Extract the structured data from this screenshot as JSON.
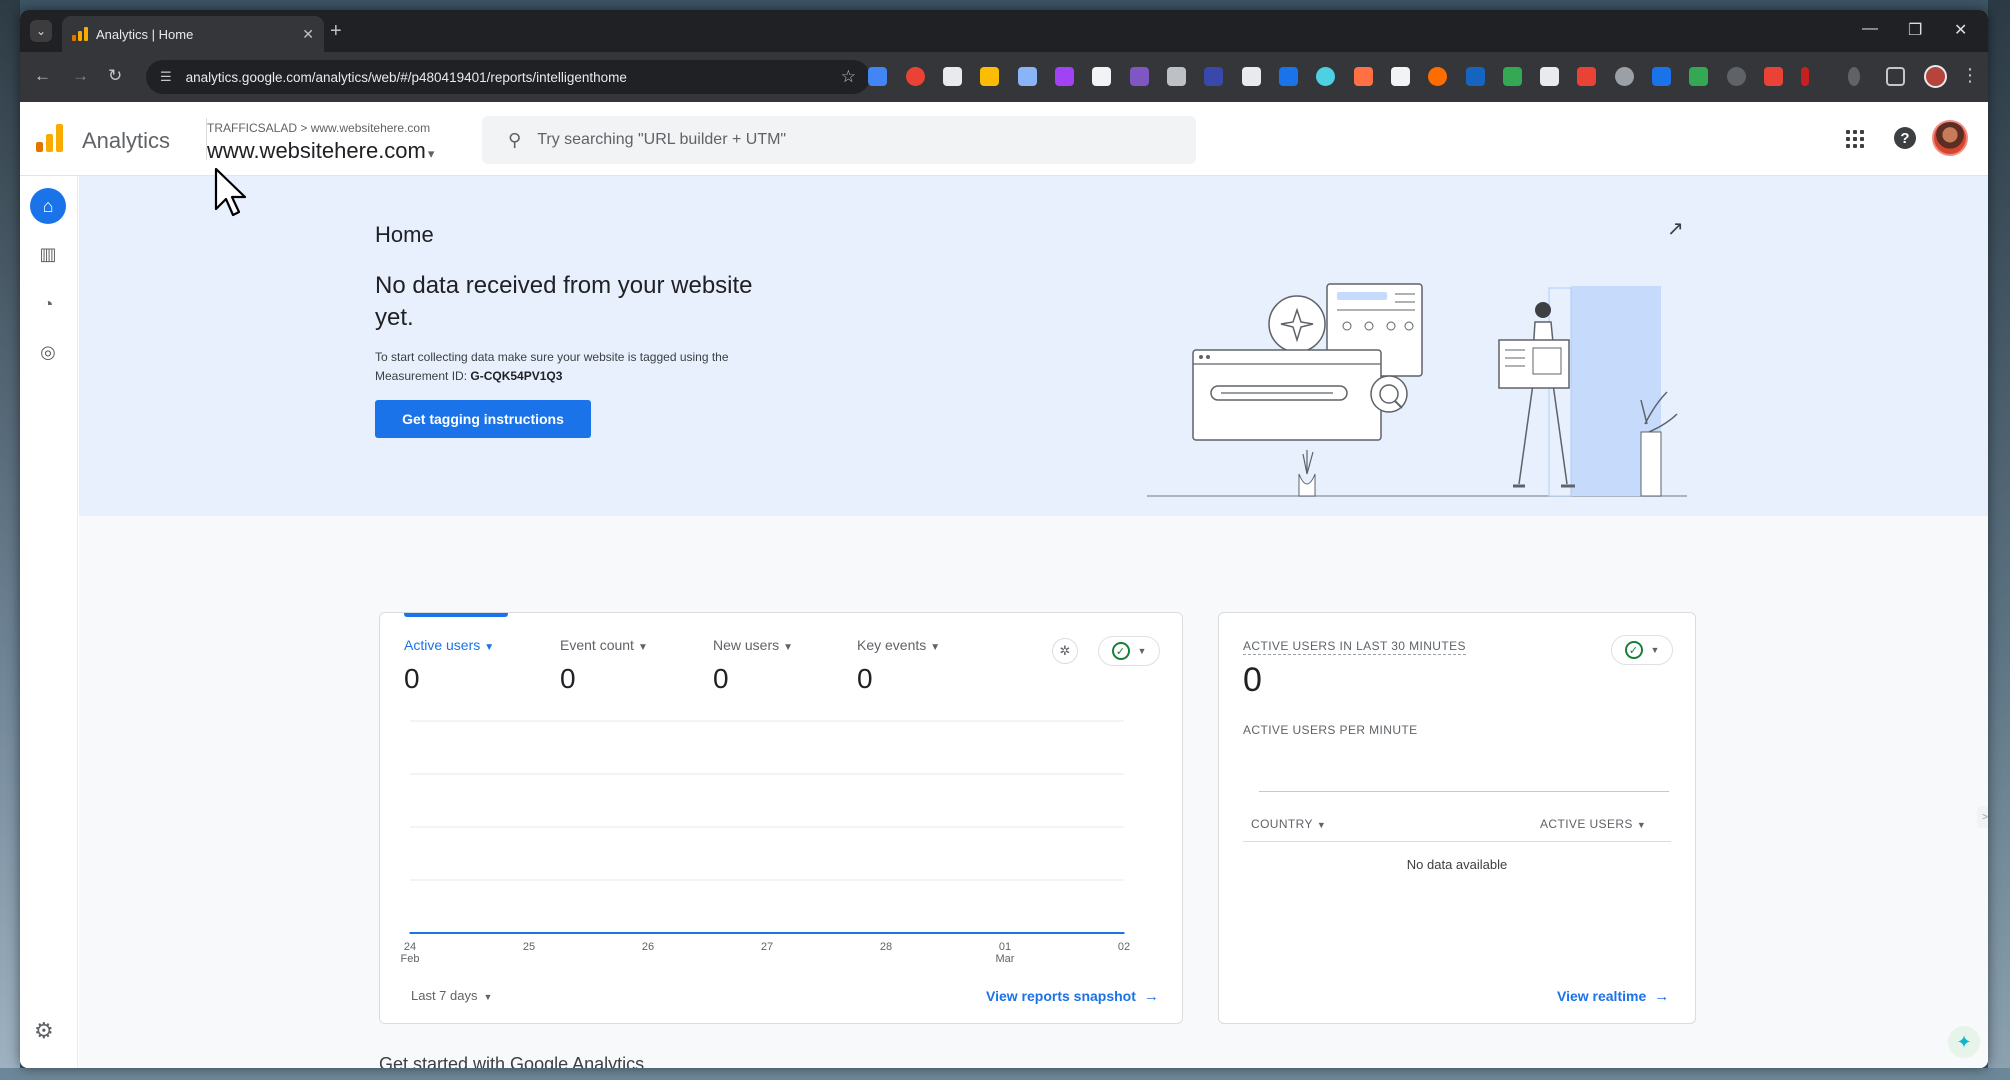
{
  "browser": {
    "tab_title": "Analytics | Home",
    "url": "analytics.google.com/analytics/web/#/p480419401/reports/intelligenthome"
  },
  "header": {
    "brand": "Analytics",
    "breadcrumb_account": "TRAFFICSALAD",
    "breadcrumb_sep": ">",
    "breadcrumb_property": "www.websitehere.com",
    "property_name": "www.websitehere.com",
    "search_placeholder": "Try searching \"URL builder + UTM\""
  },
  "hero": {
    "page_title": "Home",
    "heading": "No data received from your website yet.",
    "body_prefix": "To start collecting data make sure your website is tagged using the Measurement ID: ",
    "measurement_id": "G-CQK54PV1Q3",
    "cta_label": "Get tagging instructions"
  },
  "overview_card": {
    "metrics": [
      {
        "label": "Active users",
        "value": "0",
        "selected": true
      },
      {
        "label": "Event count",
        "value": "0",
        "selected": false
      },
      {
        "label": "New users",
        "value": "0",
        "selected": false
      },
      {
        "label": "Key events",
        "value": "0",
        "selected": false
      }
    ],
    "date_range": "Last 7 days",
    "link_label": "View reports snapshot"
  },
  "chart_data": {
    "type": "line",
    "x": [
      "24 Feb",
      "25",
      "26",
      "27",
      "28",
      "01 Mar",
      "02"
    ],
    "x_ticks": [
      {
        "top": "24",
        "bottom": "Feb"
      },
      {
        "top": "25",
        "bottom": ""
      },
      {
        "top": "26",
        "bottom": ""
      },
      {
        "top": "27",
        "bottom": ""
      },
      {
        "top": "28",
        "bottom": ""
      },
      {
        "top": "01",
        "bottom": "Mar"
      },
      {
        "top": "02",
        "bottom": ""
      }
    ],
    "series": [
      {
        "values": [
          0,
          0,
          0,
          0,
          0,
          0,
          0
        ]
      }
    ],
    "ylim": [
      0,
      4
    ],
    "grid": true,
    "color": "#1a73e8",
    "title": "",
    "xlabel": "",
    "ylabel": ""
  },
  "realtime_card": {
    "title": "ACTIVE USERS IN LAST 30 MINUTES",
    "value": "0",
    "per_minute_label": "ACTIVE USERS PER MINUTE",
    "col_country": "COUNTRY",
    "col_active": "ACTIVE USERS",
    "empty_text": "No data available",
    "link_label": "View realtime"
  },
  "footer": {
    "get_started": "Get started with Google Analytics"
  },
  "colors": {
    "accent": "#1a73e8",
    "hero_bg": "#e8f0fe",
    "success": "#188038"
  }
}
